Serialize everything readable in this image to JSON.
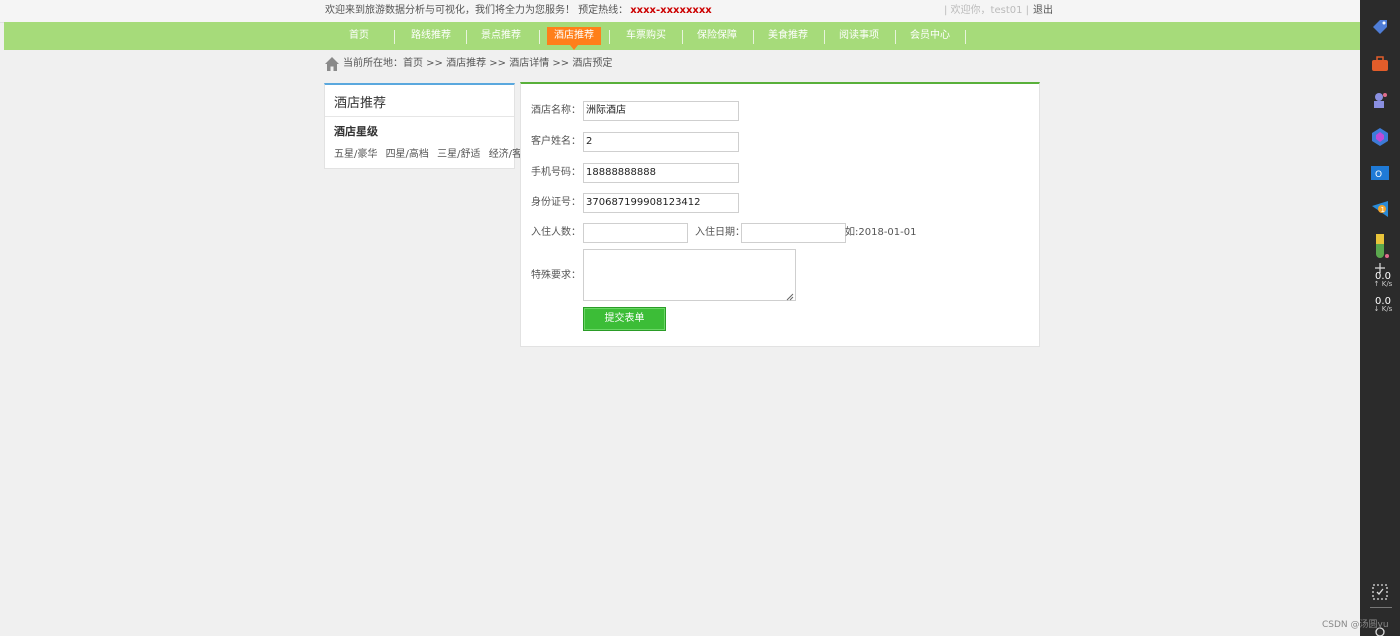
{
  "topbar": {
    "welcome": "欢迎来到旅游数据分析与可视化，我们将全力为您服务！  预定热线：",
    "hotline": "xxxx-xxxxxxxx",
    "user_greeting": "| 欢迎你，test01 |",
    "logout": "退出"
  },
  "nav": {
    "items": [
      {
        "label": "首页"
      },
      {
        "label": "路线推荐"
      },
      {
        "label": "景点推荐"
      },
      {
        "label": "酒店推荐",
        "active": true
      },
      {
        "label": "车票购买"
      },
      {
        "label": "保险保障"
      },
      {
        "label": "美食推荐"
      },
      {
        "label": "阅读事项"
      },
      {
        "label": "会员中心"
      }
    ]
  },
  "breadcrumb": {
    "text": "当前所在地：首页 >> 酒店推荐 >> 酒店详情 >> 酒店预定"
  },
  "side": {
    "title": "酒店推荐",
    "subtitle": "酒店星级",
    "links": [
      "五星/豪华",
      "四星/高档",
      "三星/舒适",
      "经济/客栈"
    ]
  },
  "form": {
    "hotel_name_label": "酒店名称：",
    "hotel_name_value": "洲际酒店",
    "customer_label": "客户姓名：",
    "customer_value": "2",
    "phone_label": "手机号码：",
    "phone_value": "18888888888",
    "id_label": "身份证号：",
    "id_value": "370687199908123412",
    "guests_label": "入住人数：",
    "guests_value": "",
    "date_label": "入住日期：",
    "date_value": "",
    "date_hint": "如:2018-01-01",
    "request_label": "特殊要求：",
    "request_value": "",
    "submit_label": "提交表单"
  },
  "system": {
    "upload_speed": "0.0",
    "upload_unit": "K/s",
    "download_speed": "0.0",
    "download_unit": "K/s",
    "watermark": "CSDN @汤圆yu"
  },
  "colors": {
    "nav_bg": "#a6db7a",
    "nav_active": "#ff7f1a",
    "submit_bg": "#3cbd37",
    "hotline": "#cc0000"
  }
}
